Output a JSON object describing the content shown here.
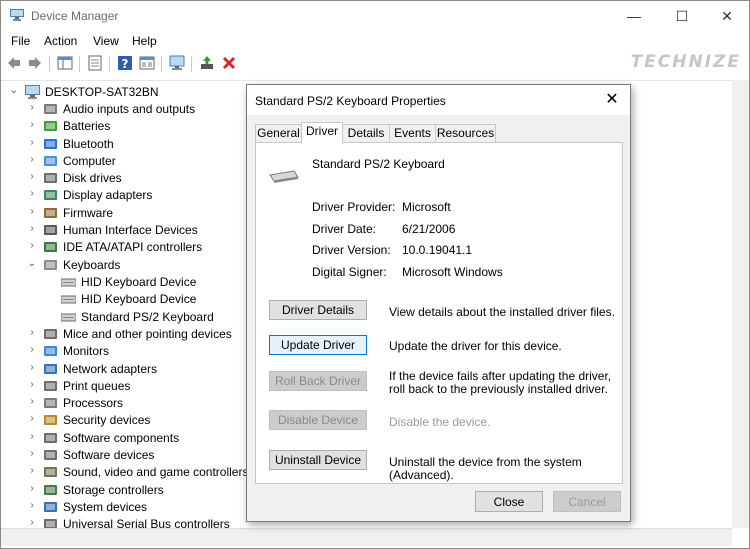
{
  "window": {
    "title": "Device Manager",
    "minimize_glyph": "—",
    "maximize_glyph": "☐",
    "close_glyph": "✕"
  },
  "watermark": "TECHNIZE",
  "menu": [
    "File",
    "Action",
    "View",
    "Help"
  ],
  "tree": {
    "root": "DESKTOP-SAT32BN",
    "categories": [
      {
        "label": "Audio inputs and outputs",
        "icon": "speaker-icon"
      },
      {
        "label": "Batteries",
        "icon": "battery-icon"
      },
      {
        "label": "Bluetooth",
        "icon": "bluetooth-icon"
      },
      {
        "label": "Computer",
        "icon": "computer-icon"
      },
      {
        "label": "Disk drives",
        "icon": "disk-drive-icon"
      },
      {
        "label": "Display adapters",
        "icon": "display-adapter-icon"
      },
      {
        "label": "Firmware",
        "icon": "firmware-icon"
      },
      {
        "label": "Human Interface Devices",
        "icon": "hid-icon"
      },
      {
        "label": "IDE ATA/ATAPI controllers",
        "icon": "ide-controller-icon"
      },
      {
        "label": "Keyboards",
        "icon": "keyboard-icon",
        "expanded": true,
        "children": [
          "HID Keyboard Device",
          "HID Keyboard Device",
          "Standard PS/2 Keyboard"
        ]
      },
      {
        "label": "Mice and other pointing devices",
        "icon": "mouse-icon"
      },
      {
        "label": "Monitors",
        "icon": "monitor-icon"
      },
      {
        "label": "Network adapters",
        "icon": "network-adapter-icon"
      },
      {
        "label": "Print queues",
        "icon": "printer-icon"
      },
      {
        "label": "Processors",
        "icon": "processor-icon"
      },
      {
        "label": "Security devices",
        "icon": "security-device-icon"
      },
      {
        "label": "Software components",
        "icon": "software-component-icon"
      },
      {
        "label": "Software devices",
        "icon": "software-device-icon"
      },
      {
        "label": "Sound, video and game controllers",
        "icon": "sound-controller-icon"
      },
      {
        "label": "Storage controllers",
        "icon": "storage-controller-icon"
      },
      {
        "label": "System devices",
        "icon": "system-device-icon"
      },
      {
        "label": "Universal Serial Bus controllers",
        "icon": "usb-icon"
      }
    ]
  },
  "dialog": {
    "title": "Standard PS/2 Keyboard Properties",
    "close_glyph": "✕",
    "tabs": [
      "General",
      "Driver",
      "Details",
      "Events",
      "Resources"
    ],
    "active_tab": "Driver",
    "device_name": "Standard PS/2 Keyboard",
    "properties": [
      {
        "label": "Driver Provider:",
        "value": "Microsoft"
      },
      {
        "label": "Driver Date:",
        "value": "6/21/2006"
      },
      {
        "label": "Driver Version:",
        "value": "10.0.19041.1"
      },
      {
        "label": "Digital Signer:",
        "value": "Microsoft Windows"
      }
    ],
    "actions": [
      {
        "button": "Driver Details",
        "desc": "View details about the installed driver files.",
        "enabled": true
      },
      {
        "button": "Update Driver",
        "desc": "Update the driver for this device.",
        "enabled": true,
        "focused": true
      },
      {
        "button": "Roll Back Driver",
        "desc": "If the device fails after updating the driver, roll back to the previously installed driver.",
        "enabled": false
      },
      {
        "button": "Disable Device",
        "desc": "Disable the device.",
        "enabled": false
      },
      {
        "button": "Uninstall Device",
        "desc": "Uninstall the device from the system (Advanced).",
        "enabled": true
      }
    ],
    "close_button": "Close",
    "cancel_button": "Cancel"
  }
}
